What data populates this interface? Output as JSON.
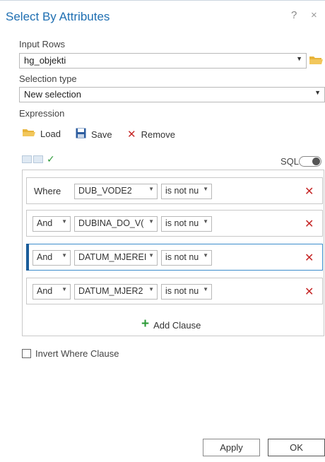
{
  "dialog": {
    "title": "Select By Attributes",
    "help_symbol": "?",
    "close_symbol": "×"
  },
  "input_rows": {
    "label": "Input Rows",
    "value": "hg_objekti",
    "browse_icon": "folder-open-icon"
  },
  "selection_type": {
    "label": "Selection type",
    "value": "New selection"
  },
  "expression": {
    "label": "Expression",
    "load_label": "Load",
    "save_label": "Save",
    "remove_label": "Remove",
    "sql_label": "SQL",
    "sql_toggle_on": false
  },
  "clauses": [
    {
      "conjunction": "Where",
      "field": "DUB_VODE2",
      "operator": "is not nu"
    },
    {
      "conjunction": "And",
      "field": "DUBINA_DO_V(",
      "operator": "is not nu"
    },
    {
      "conjunction": "And",
      "field": "DATUM_MJEREI",
      "operator": "is not nu"
    },
    {
      "conjunction": "And",
      "field": "DATUM_MJER2",
      "operator": "is not nu"
    }
  ],
  "add_clause_label": "Add Clause",
  "invert_label": "Invert Where Clause",
  "invert_checked": false,
  "footer": {
    "apply_label": "Apply",
    "ok_label": "OK"
  },
  "colors": {
    "title_blue": "#1f6fb2",
    "remove_red": "#c62828",
    "check_green": "#2e9b3a",
    "active_clause_bar": "#1a5d9a"
  }
}
